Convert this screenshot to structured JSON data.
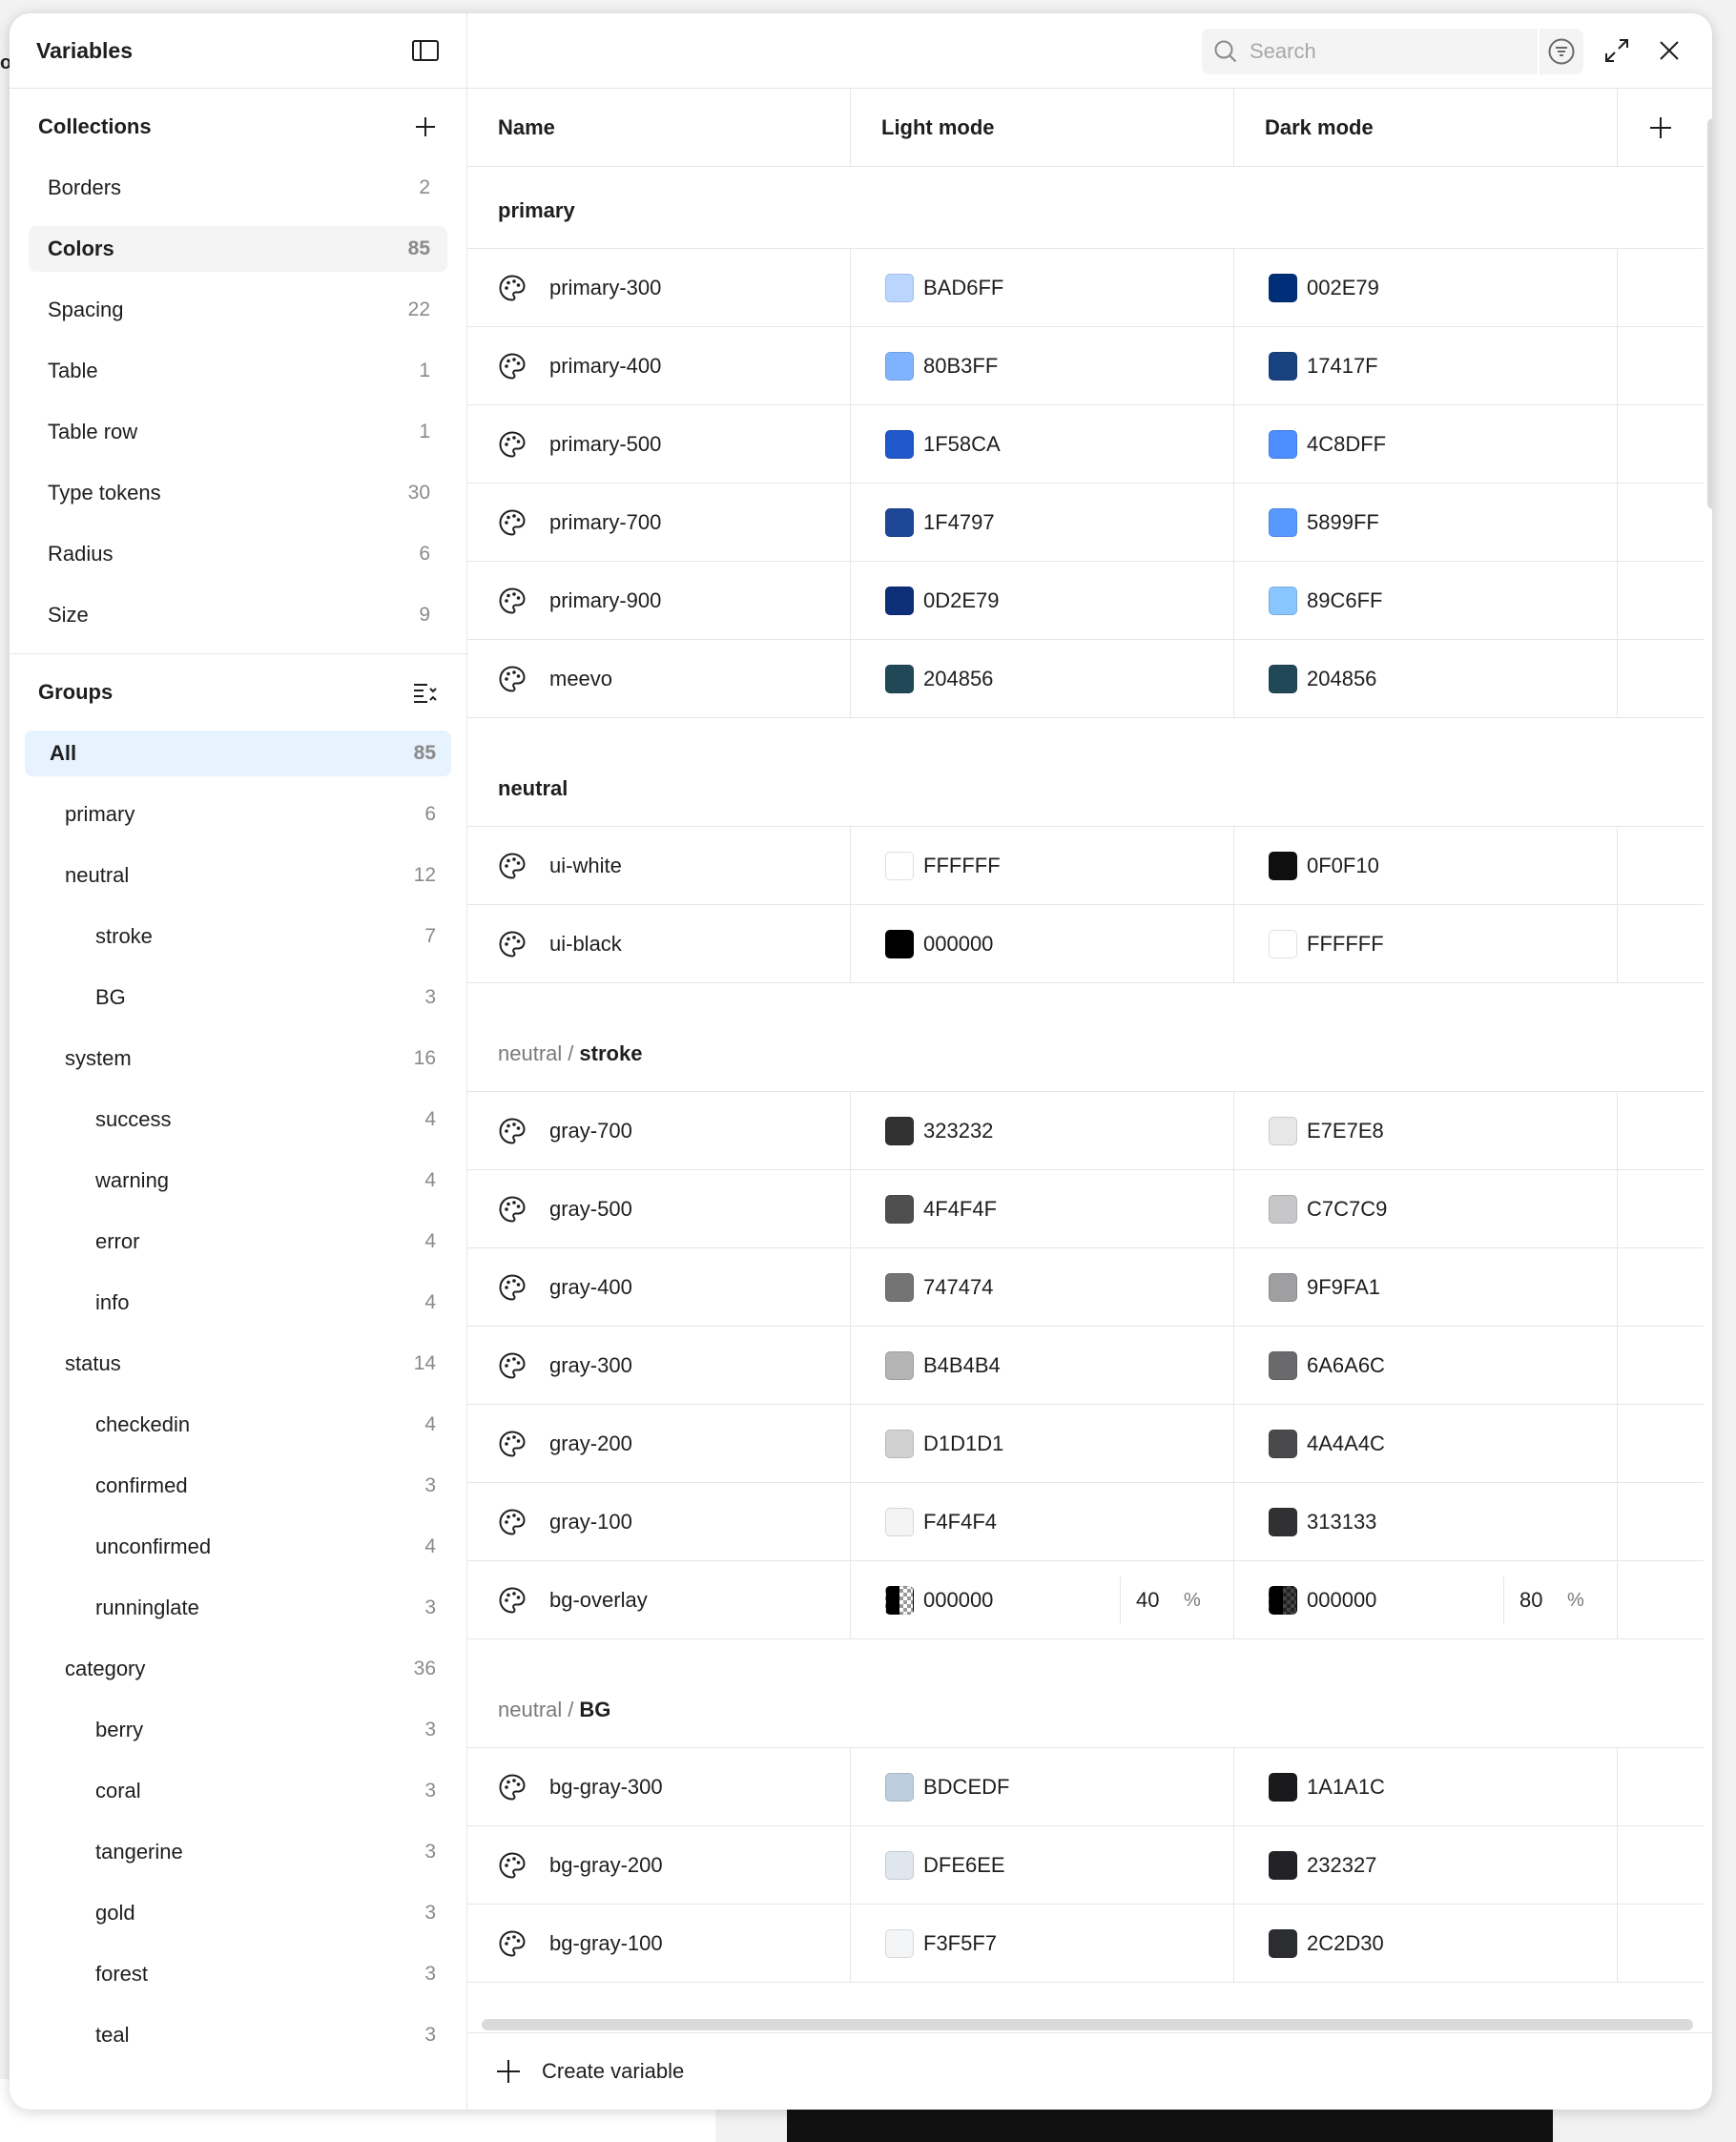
{
  "background": {
    "edge_text": "or"
  },
  "sidebar": {
    "title": "Variables",
    "collections_title": "Collections",
    "collections": [
      {
        "label": "Borders",
        "count": "2"
      },
      {
        "label": "Colors",
        "count": "85"
      },
      {
        "label": "Spacing",
        "count": "22"
      },
      {
        "label": "Table",
        "count": "1"
      },
      {
        "label": "Table row",
        "count": "1"
      },
      {
        "label": "Type tokens",
        "count": "30"
      },
      {
        "label": "Radius",
        "count": "6"
      },
      {
        "label": "Size",
        "count": "9"
      }
    ],
    "groups_title": "Groups",
    "groups": [
      {
        "label": "All",
        "count": "85",
        "level": 0
      },
      {
        "label": "primary",
        "count": "6",
        "level": 1
      },
      {
        "label": "neutral",
        "count": "12",
        "level": 1
      },
      {
        "label": "stroke",
        "count": "7",
        "level": 2
      },
      {
        "label": "BG",
        "count": "3",
        "level": 2
      },
      {
        "label": "system",
        "count": "16",
        "level": 1
      },
      {
        "label": "success",
        "count": "4",
        "level": 2
      },
      {
        "label": "warning",
        "count": "4",
        "level": 2
      },
      {
        "label": "error",
        "count": "4",
        "level": 2
      },
      {
        "label": "info",
        "count": "4",
        "level": 2
      },
      {
        "label": "status",
        "count": "14",
        "level": 1
      },
      {
        "label": "checkedin",
        "count": "4",
        "level": 2
      },
      {
        "label": "confirmed",
        "count": "3",
        "level": 2
      },
      {
        "label": "unconfirmed",
        "count": "4",
        "level": 2
      },
      {
        "label": "runninglate",
        "count": "3",
        "level": 2
      },
      {
        "label": "category",
        "count": "36",
        "level": 1
      },
      {
        "label": "berry",
        "count": "3",
        "level": 2
      },
      {
        "label": "coral",
        "count": "3",
        "level": 2
      },
      {
        "label": "tangerine",
        "count": "3",
        "level": 2
      },
      {
        "label": "gold",
        "count": "3",
        "level": 2
      },
      {
        "label": "forest",
        "count": "3",
        "level": 2
      },
      {
        "label": "teal",
        "count": "3",
        "level": 2
      }
    ]
  },
  "search": {
    "placeholder": "Search"
  },
  "table": {
    "headers": {
      "name": "Name",
      "light": "Light mode",
      "dark": "Dark mode"
    },
    "groups": [
      {
        "parent": "",
        "sep": "",
        "name": "primary",
        "rows": [
          {
            "name": "primary-300",
            "light": "BAD6FF",
            "light_color": "#BAD6FF",
            "dark": "002E79",
            "dark_color": "#002E79"
          },
          {
            "name": "primary-400",
            "light": "80B3FF",
            "light_color": "#80B3FF",
            "dark": "17417F",
            "dark_color": "#17417F"
          },
          {
            "name": "primary-500",
            "light": "1F58CA",
            "light_color": "#1F58CA",
            "dark": "4C8DFF",
            "dark_color": "#4C8DFF"
          },
          {
            "name": "primary-700",
            "light": "1F4797",
            "light_color": "#1F4797",
            "dark": "5899FF",
            "dark_color": "#5899FF"
          },
          {
            "name": "primary-900",
            "light": "0D2E79",
            "light_color": "#0D2E79",
            "dark": "89C6FF",
            "dark_color": "#89C6FF"
          },
          {
            "name": "meevo",
            "light": "204856",
            "light_color": "#204856",
            "dark": "204856",
            "dark_color": "#204856"
          }
        ]
      },
      {
        "parent": "",
        "sep": "",
        "name": "neutral",
        "rows": [
          {
            "name": "ui-white",
            "light": "FFFFFF",
            "light_color": "#FFFFFF",
            "dark": "0F0F10",
            "dark_color": "#0F0F10"
          },
          {
            "name": "ui-black",
            "light": "000000",
            "light_color": "#000000",
            "dark": "FFFFFF",
            "dark_color": "#FFFFFF"
          }
        ]
      },
      {
        "parent": "neutral",
        "sep": "/",
        "name": "stroke",
        "rows": [
          {
            "name": "gray-700",
            "light": "323232",
            "light_color": "#323232",
            "dark": "E7E7E8",
            "dark_color": "#E7E7E8"
          },
          {
            "name": "gray-500",
            "light": "4F4F4F",
            "light_color": "#4F4F4F",
            "dark": "C7C7C9",
            "dark_color": "#C7C7C9"
          },
          {
            "name": "gray-400",
            "light": "747474",
            "light_color": "#747474",
            "dark": "9F9FA1",
            "dark_color": "#9F9FA1"
          },
          {
            "name": "gray-300",
            "light": "B4B4B4",
            "light_color": "#B4B4B4",
            "dark": "6A6A6C",
            "dark_color": "#6A6A6C"
          },
          {
            "name": "gray-200",
            "light": "D1D1D1",
            "light_color": "#D1D1D1",
            "dark": "4A4A4C",
            "dark_color": "#4A4A4C"
          },
          {
            "name": "gray-100",
            "light": "F4F4F4",
            "light_color": "#F4F4F4",
            "dark": "313133",
            "dark_color": "#313133"
          },
          {
            "name": "bg-overlay",
            "light": "000000",
            "light_color": "#000000",
            "light_opacity": "40",
            "dark": "000000",
            "dark_color": "#000000",
            "dark_opacity": "80",
            "percent": "%"
          }
        ]
      },
      {
        "parent": "neutral",
        "sep": "/",
        "name": "BG",
        "rows": [
          {
            "name": "bg-gray-300",
            "light": "BDCEDF",
            "light_color": "#BDCEDF",
            "dark": "1A1A1C",
            "dark_color": "#1A1A1C"
          },
          {
            "name": "bg-gray-200",
            "light": "DFE6EE",
            "light_color": "#DFE6EE",
            "dark": "232327",
            "dark_color": "#232327"
          },
          {
            "name": "bg-gray-100",
            "light": "F3F5F7",
            "light_color": "#F3F5F7",
            "dark": "2C2D30",
            "dark_color": "#2C2D30"
          }
        ]
      }
    ]
  },
  "footer": {
    "create_label": "Create variable"
  }
}
